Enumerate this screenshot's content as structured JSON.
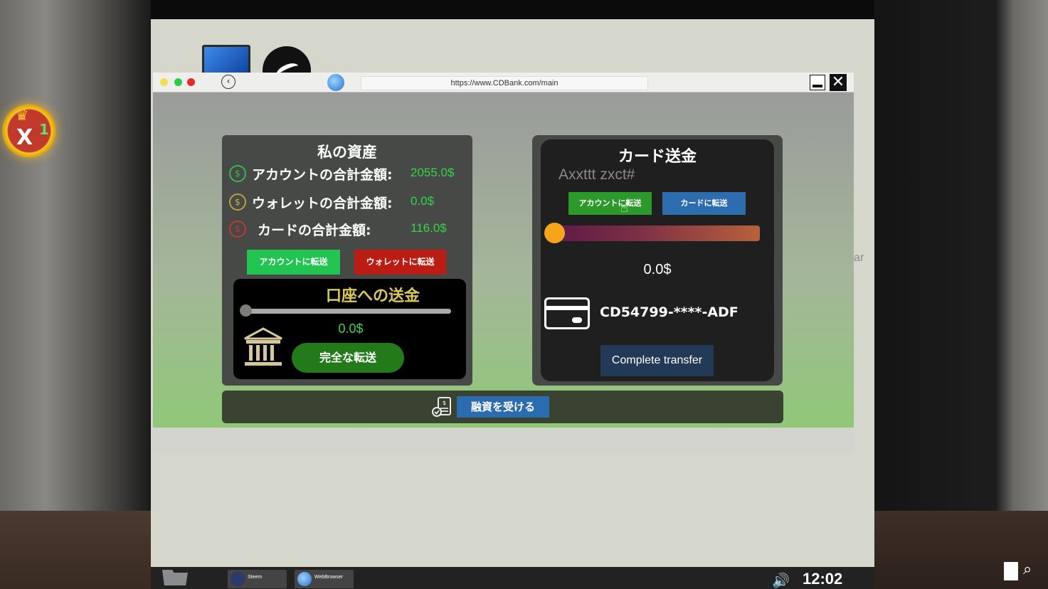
{
  "hud": {
    "crown_multiplier": "X",
    "crown_count": "1"
  },
  "browser": {
    "url": "https://www.CDBank.com/main"
  },
  "assets": {
    "title": "私の資産",
    "rows": [
      {
        "label": "アカウントの合計金額:",
        "value": "2055.0$"
      },
      {
        "label": "ウォレットの合計金額:",
        "value": "0.0$"
      },
      {
        "label": "カードの合計金額:",
        "value": "116.0$"
      }
    ],
    "btn_to_account": "アカウントに転送",
    "btn_to_wallet": "ウォレットに転送",
    "deposit": {
      "title": "口座への送金",
      "amount": "0.0$",
      "complete_label": "完全な転送",
      "slider_level": 0
    }
  },
  "card_transfer": {
    "title": "カード送金",
    "input_text": "Axxttt zxct#",
    "btn_to_account": "アカウントに転送",
    "btn_to_card": "カードに転送",
    "slider_level": 0,
    "amount": "0.0$",
    "card_number": "CD54799-****-ADF",
    "complete_label": "Complete transfer",
    "edge_text": "ar"
  },
  "loan": {
    "label": "融資を受ける"
  },
  "taskbar": {
    "items": [
      {
        "label": "Steem",
        "icon": "steem-icon"
      },
      {
        "label": "WebBrowser",
        "icon": "globe-icon"
      }
    ],
    "clock": "12:02"
  },
  "colors": {
    "green_value": "#35d34a",
    "green_button": "#22c552",
    "red_button": "#bb1c13",
    "blue_button": "#2d6cae",
    "slider_knob": "#f5a41c",
    "gold_title": "#dcc85a"
  }
}
